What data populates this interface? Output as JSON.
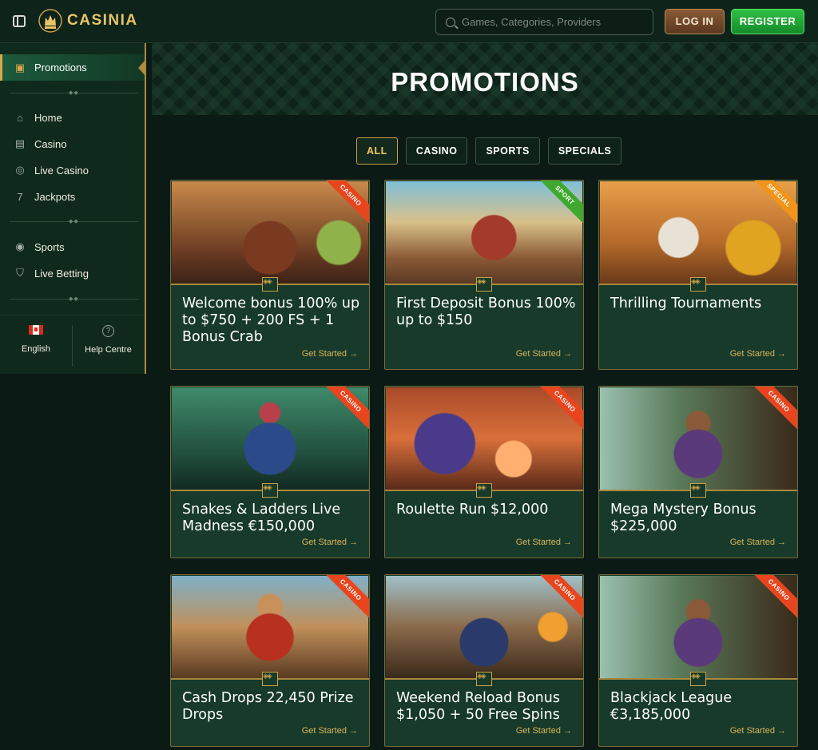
{
  "header": {
    "brand": "CASINIA",
    "search_placeholder": "Games, Categories, Providers",
    "login_label": "LOG IN",
    "register_label": "REGISTER"
  },
  "sidebar": {
    "active": "Promotions",
    "items": [
      {
        "label": "Home",
        "icon": "castle-icon"
      },
      {
        "label": "Casino",
        "icon": "treasure-icon"
      },
      {
        "label": "Live Casino",
        "icon": "chip-icon"
      },
      {
        "label": "Jackpots",
        "icon": "seven-icon"
      },
      {
        "label": "Sports",
        "icon": "ball-icon"
      },
      {
        "label": "Live Betting",
        "icon": "shield-icon"
      }
    ],
    "language": "English",
    "help": "Help Centre"
  },
  "main": {
    "title": "PROMOTIONS",
    "tabs": [
      "ALL",
      "CASINO",
      "SPORTS",
      "SPECIALS"
    ],
    "active_tab": "ALL",
    "cta_label": "Get Started →",
    "cards": [
      {
        "title": "Welcome bonus 100% up to $750 + 200 FS + 1 Bonus Crab",
        "badge": "CASINO"
      },
      {
        "title": "First Deposit Bonus 100% up to $150",
        "badge": "SPORT"
      },
      {
        "title": "Thrilling Tournaments",
        "badge": "SPECIAL"
      },
      {
        "title": "Snakes & Ladders Live Madness €150,000",
        "badge": "CASINO"
      },
      {
        "title": "Roulette Run $12,000",
        "badge": "CASINO"
      },
      {
        "title": "Mega Mystery Bonus $225,000",
        "badge": "CASINO"
      },
      {
        "title": "Cash Drops 22,450 Prize Drops",
        "badge": "CASINO"
      },
      {
        "title": "Weekend Reload Bonus $1,050 + 50 Free Spins",
        "badge": "CASINO"
      },
      {
        "title": "Blackjack League €3,185,000",
        "badge": "CASINO"
      }
    ]
  },
  "colors": {
    "background": "#0b1a14",
    "accent_gold": "#e9c466",
    "register_green": "#1fa834",
    "casino_ribbon": "#e8451e",
    "sport_ribbon": "#3fa82e",
    "special_ribbon": "#f29419"
  }
}
